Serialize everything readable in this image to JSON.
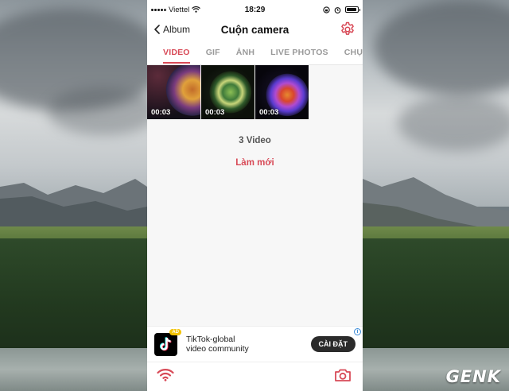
{
  "status_bar": {
    "carrier": "Viettel",
    "time": "18:29",
    "battery_level": 0.9
  },
  "nav": {
    "back_label": "Album",
    "title": "Cuộn camera"
  },
  "tabs": [
    {
      "label": "VIDEO",
      "active": true
    },
    {
      "label": "GIF",
      "active": false
    },
    {
      "label": "ẢNH",
      "active": false
    },
    {
      "label": "LIVE PHOTOS",
      "active": false
    },
    {
      "label": "CHỤP",
      "active": false
    }
  ],
  "videos": [
    {
      "duration": "00:03"
    },
    {
      "duration": "00:03"
    },
    {
      "duration": "00:03"
    }
  ],
  "summary": {
    "count_label": "3 Video",
    "refresh_label": "Làm mới"
  },
  "ad": {
    "badge": "AD",
    "title": "TikTok-global",
    "subtitle": "video community",
    "cta": "CÀI ĐẶT",
    "info": "i"
  },
  "watermark": "GENK",
  "colors": {
    "accent": "#d84a57",
    "ad_button": "#2b2b2b"
  },
  "icons": {
    "back": "chevron-left-icon",
    "settings": "gear-icon",
    "wifi": "wifi-icon",
    "camera": "camera-icon"
  }
}
